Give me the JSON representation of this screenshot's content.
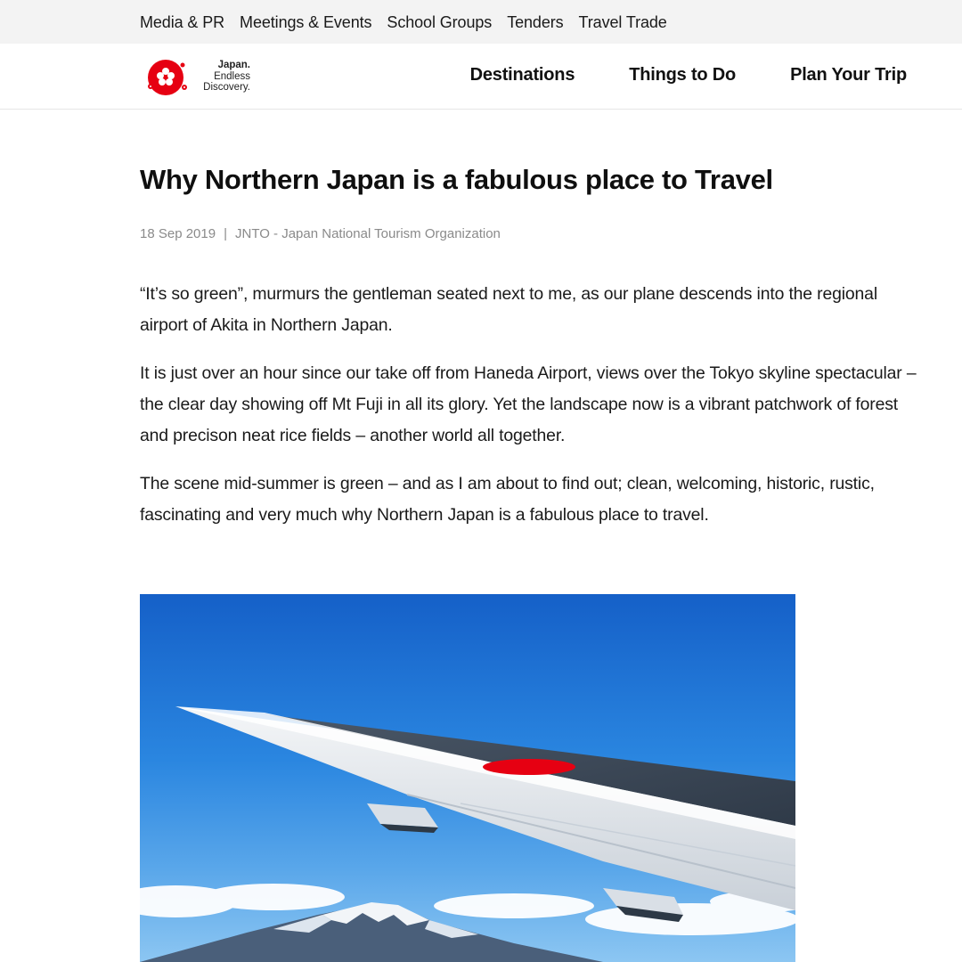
{
  "utility_nav": {
    "links": [
      "Media & PR",
      "Meetings & Events",
      "School Groups",
      "Tenders",
      "Travel Trade"
    ]
  },
  "header": {
    "logo": {
      "line1": "Japan.",
      "line2": "Endless",
      "line3": "Discovery."
    },
    "nav": [
      "Destinations",
      "Things to Do",
      "Plan Your Trip"
    ]
  },
  "article": {
    "title": "Why Northern Japan is a fabulous place to Travel",
    "date": "18 Sep 2019",
    "separator": "|",
    "author": "JNTO - Japan National Tourism Organization",
    "paragraphs": [
      "“It’s so green”, murmurs the gentleman seated next to me, as our plane descends into the regional airport of Akita in Northern Japan.",
      "It is just over an hour since our take off from Haneda Airport, views over the Tokyo skyline spectacular – the clear day showing off Mt Fuji in all its glory. Yet the landscape now is a vibrant patchwork of forest and precison neat rice fields – another world all together.",
      "The scene mid-summer is green – and as I am about to find out; clean, welcoming, historic, rustic, fascinating and very much why Northern Japan is a fabulous place to travel."
    ]
  },
  "colors": {
    "brand_red": "#e60012",
    "sky_top": "#1560c8",
    "sky_bottom": "#6fb4ee"
  }
}
